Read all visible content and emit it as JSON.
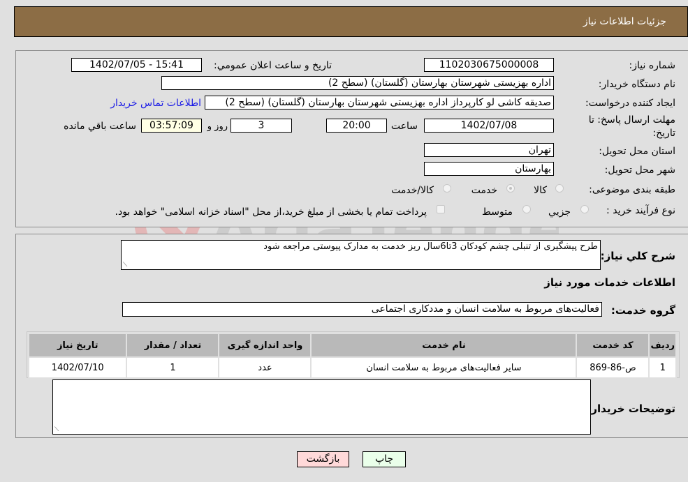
{
  "header": {
    "title": "جزئیات اطلاعات نیاز"
  },
  "form": {
    "need_number_label": "شماره نیاز:",
    "need_number": "1102030675000008",
    "announce_label": "تاریخ و ساعت اعلان عمومي:",
    "announce_value": "1402/07/05 - 15:41",
    "buyer_org_label": "نام دستگاه خریدار:",
    "buyer_org": "اداره بهزیستی شهرستان بهارستان (گلستان) (سطح 2)",
    "creator_label": "ایجاد کننده درخواست:",
    "creator": "صدیقه کاشی لو کارپرداز اداره بهزیستی شهرستان بهارستان (گلستان) (سطح 2)",
    "contact_link": "اطلاعات تماس خریدار",
    "deadline_label": "مهلت ارسال پاسخ: تا تاریخ:",
    "deadline_date": "1402/07/08",
    "time_label": "ساعت",
    "deadline_time": "20:00",
    "days_value": "3",
    "days_label": "روز و",
    "remaining_time": "03:57:09",
    "remaining_label": "ساعت باقي مانده",
    "province_label": "استان محل تحویل:",
    "province": "تهران",
    "city_label": "شهر محل تحویل:",
    "city": "بهارستان",
    "category_label": "طبقه بندی موضوعی:",
    "category_options": [
      "کالا",
      "خدمت",
      "کالا/خدمت"
    ],
    "category_selected": "خدمت",
    "process_label": "نوع فرآیند خرید :",
    "process_options": [
      "جزيي",
      "متوسط"
    ],
    "treasury_note": "پرداخت تمام یا بخشی از مبلغ خرید،از محل \"اسناد خزانه اسلامی\" خواهد بود."
  },
  "details": {
    "description_label": "شرح كلي نياز:",
    "description": "طرح پیشگیری از تنبلی چشم کودکان 3تا6سال ریز خدمت به مدارک پیوستی مراجعه شود",
    "services_heading": "اطلاعات خدمات مورد نیاز",
    "service_group_label": "گروه خدمت:",
    "service_group": "فعالیت‌های مربوط به سلامت انسان و مددکاری اجتماعی",
    "table": {
      "headers": [
        "ردیف",
        "کد خدمت",
        "نام خدمت",
        "واحد اندازه گیری",
        "تعداد / مقدار",
        "تاریخ نیاز"
      ],
      "rows": [
        [
          "1",
          "ص-86-869",
          "سایر فعالیت‌های مربوط به سلامت انسان",
          "عدد",
          "1",
          "1402/07/10"
        ]
      ]
    },
    "buyer_notes_label": "توضیحات خریدار:",
    "buyer_notes": ""
  },
  "buttons": {
    "print": "چاپ",
    "back": "بازگشت"
  },
  "watermark": "AriaTender.net"
}
